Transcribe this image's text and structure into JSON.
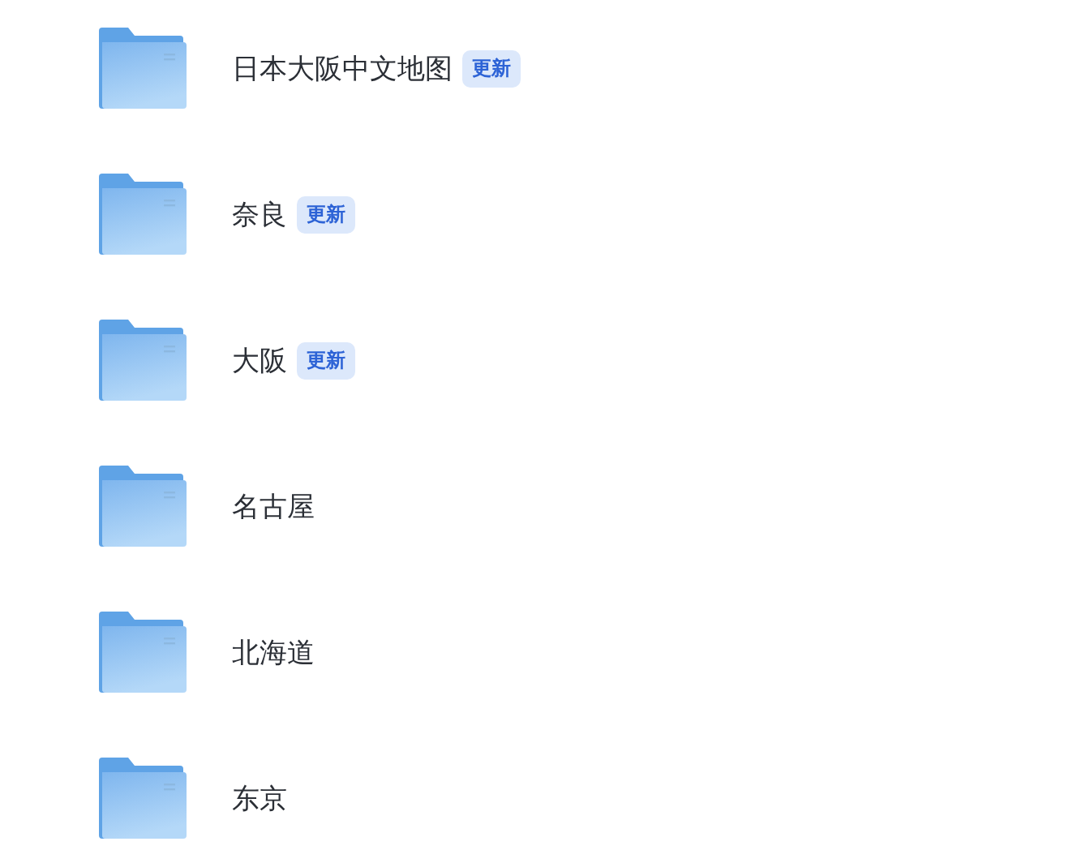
{
  "folders": [
    {
      "name": "日本大阪中文地图",
      "badge": "更新"
    },
    {
      "name": "奈良",
      "badge": "更新"
    },
    {
      "name": "大阪",
      "badge": "更新"
    },
    {
      "name": "名古屋"
    },
    {
      "name": "北海道"
    },
    {
      "name": "东京"
    }
  ]
}
